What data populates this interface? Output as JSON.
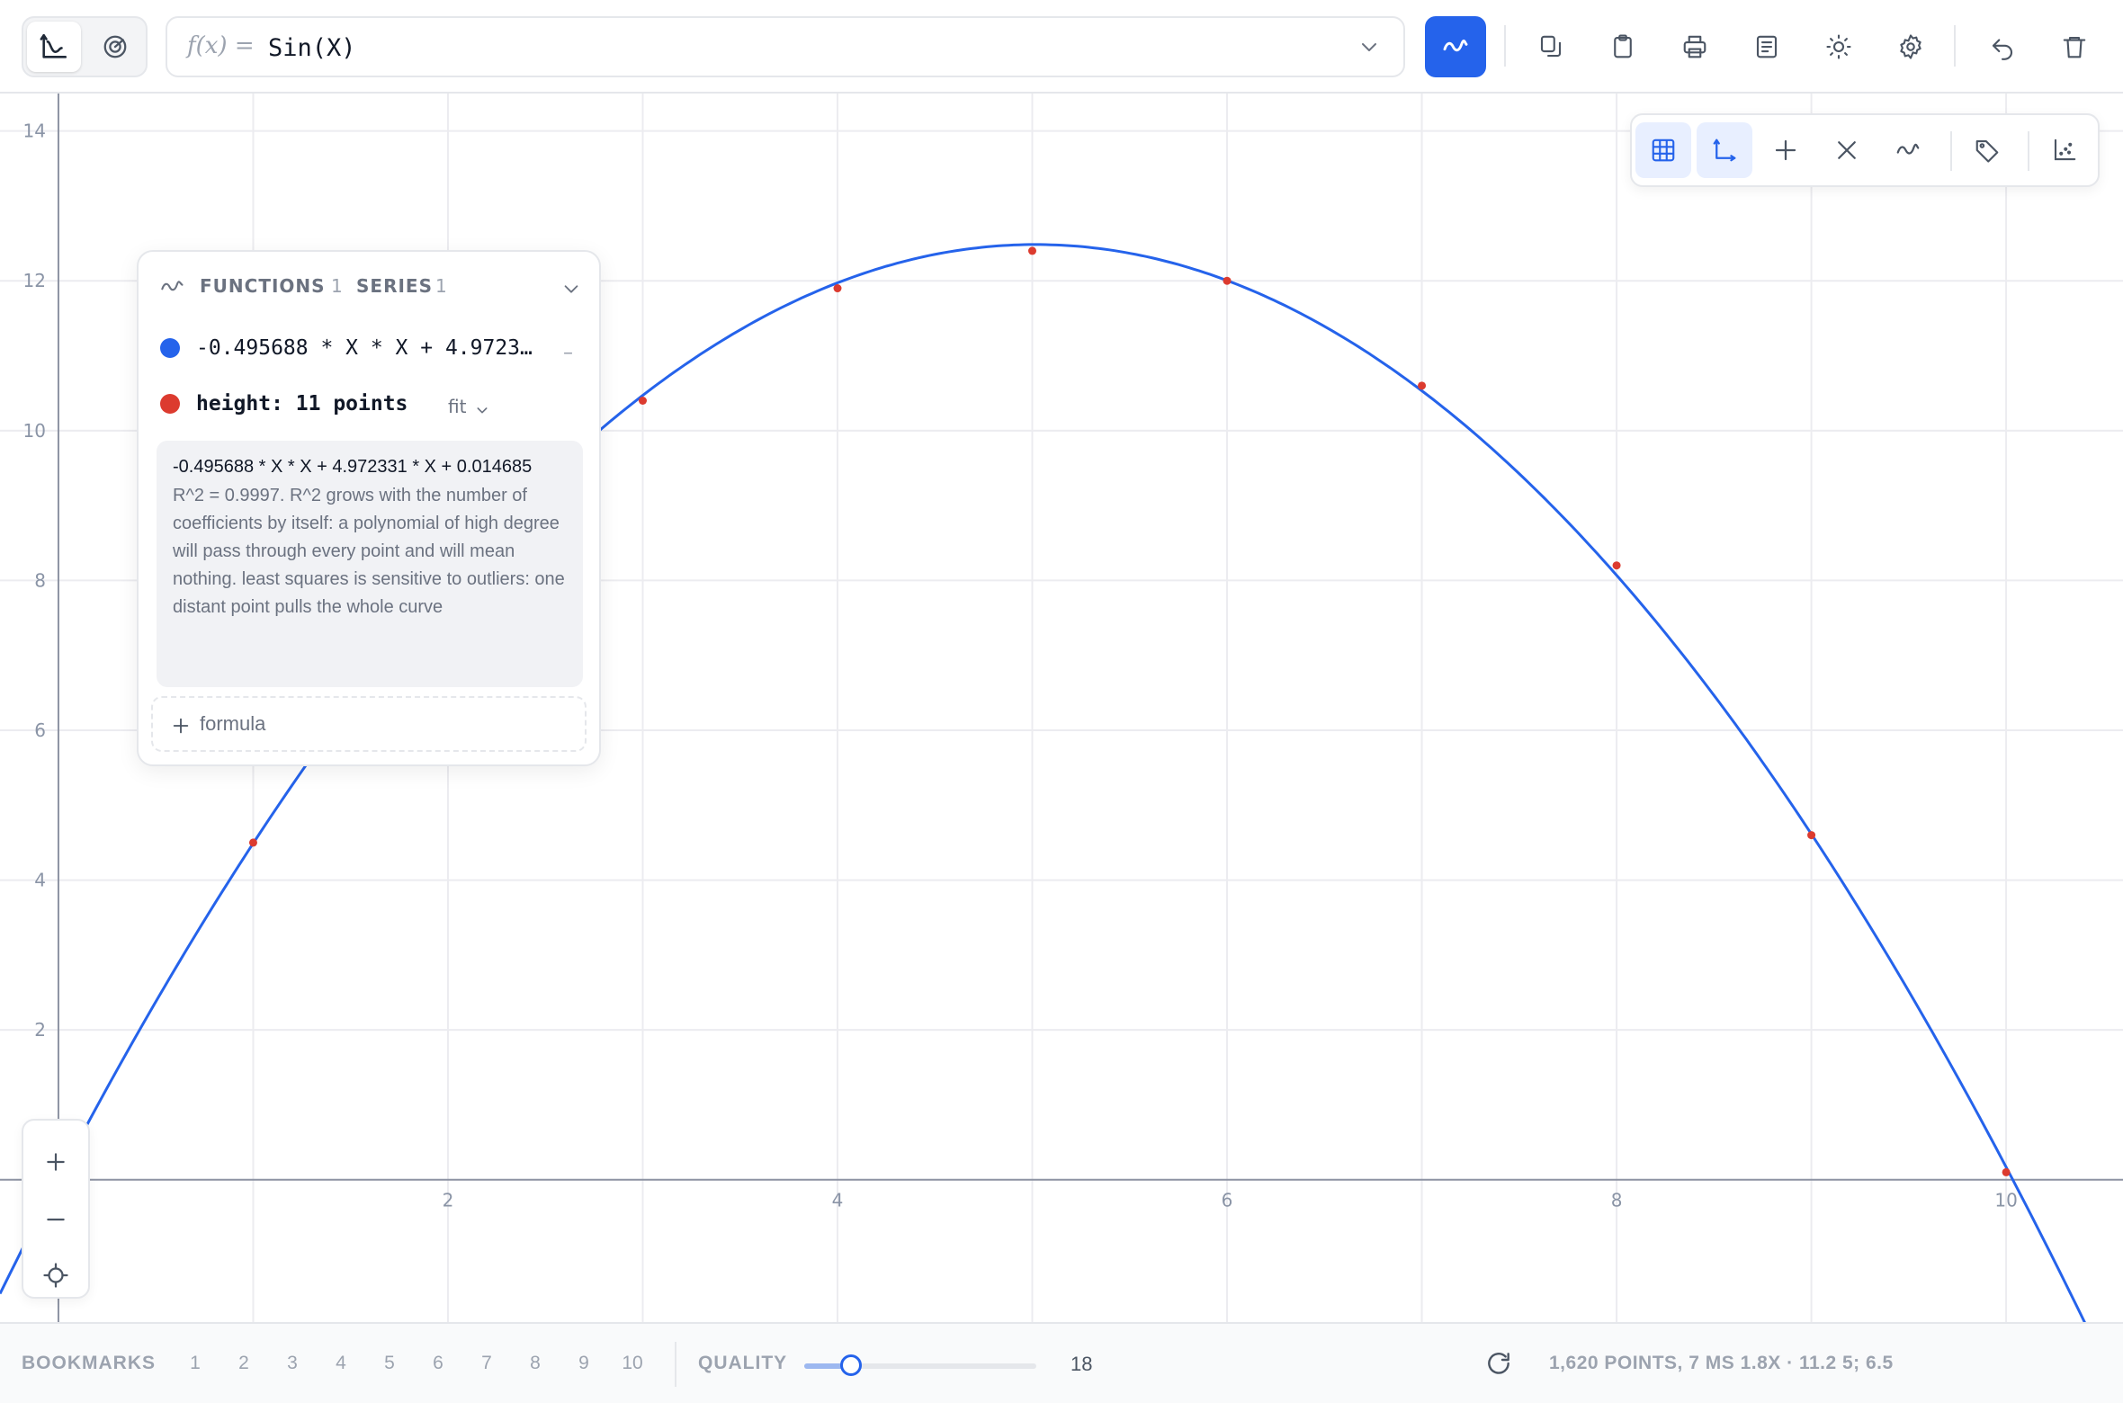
{
  "toolbar": {
    "modes": [
      {
        "name": "graph-mode",
        "icon": "axes-chart-icon",
        "active": true
      },
      {
        "name": "polar-mode",
        "icon": "target-icon",
        "active": false
      }
    ],
    "formula_prefix": "f(x) =",
    "formula_value": "Sin(X)",
    "plot_button_icon": "wave-icon",
    "actions": [
      {
        "name": "copy-button",
        "icon": "copy-icon"
      },
      {
        "name": "paste-button",
        "icon": "clipboard-icon"
      },
      {
        "name": "print-button",
        "icon": "printer-icon"
      },
      {
        "name": "document-button",
        "icon": "document-icon"
      },
      {
        "name": "theme-button",
        "icon": "sun-icon"
      },
      {
        "name": "settings-button",
        "icon": "gear-icon"
      },
      {
        "name": "undo-button",
        "icon": "undo-icon"
      },
      {
        "name": "delete-button",
        "icon": "trash-icon"
      }
    ]
  },
  "plot_tools": [
    {
      "name": "grid-toggle",
      "icon": "grid-icon",
      "active": true
    },
    {
      "name": "axes-toggle",
      "icon": "axes-icon",
      "active": true
    },
    {
      "name": "crosshair-toggle",
      "icon": "plus-icon",
      "active": false
    },
    {
      "name": "intersections-toggle",
      "icon": "x-icon",
      "active": false
    },
    {
      "name": "derivative-toggle",
      "icon": "wave-icon",
      "active": false
    },
    {
      "name": "labels-toggle",
      "icon": "tag-icon",
      "active": false
    },
    {
      "name": "scatter-toggle",
      "icon": "scatter-icon",
      "active": false
    }
  ],
  "panel": {
    "functions_label": "FUNCTIONS",
    "functions_count": "1",
    "series_label": "SERIES",
    "series_count": "1",
    "function_row": {
      "text": "-0.495688 * X * X + 4.9723…",
      "color": "#2563eb"
    },
    "series_row": {
      "text": "height: 11 points",
      "color": "#dc3b2f",
      "fit_label": "fit"
    },
    "fit": {
      "formula": "-0.495688 * X * X + 4.972331 * X + 0.014685",
      "description": "R^2 = 0.9997. R^2 grows with the number of coefficients by itself: a polynomial of high degree will pass through every point and will mean nothing. least squares is sensitive to outliers: one distant point pulls the whole curve"
    },
    "add_formula_label": "formula"
  },
  "chart_data": {
    "type": "scatter",
    "title": "",
    "xlabel": "",
    "ylabel": "",
    "xlim": [
      -0.3,
      10.6
    ],
    "ylim": [
      -1.9,
      14.5
    ],
    "x_ticks": [
      2,
      4,
      6,
      8,
      10
    ],
    "y_ticks": [
      2,
      4,
      6,
      8,
      10,
      12,
      14
    ],
    "grid": true,
    "fit_curve": {
      "a": -0.495688,
      "b": 4.972331,
      "c": 0.014685,
      "color": "#2563eb"
    },
    "series": [
      {
        "name": "height",
        "color": "#dc3b2f",
        "x": [
          0,
          1,
          2,
          3,
          4,
          5,
          6,
          7,
          8,
          9,
          10
        ],
        "y": [
          0.0,
          4.5,
          8.0,
          10.4,
          11.9,
          12.4,
          12.0,
          10.6,
          8.2,
          4.6,
          0.1
        ]
      }
    ]
  },
  "zoom": [
    {
      "name": "zoom-in-button",
      "icon": "plus-icon"
    },
    {
      "name": "zoom-out-button",
      "icon": "minus-icon"
    },
    {
      "name": "recenter-button",
      "icon": "crosshair-icon"
    }
  ],
  "bottom": {
    "bookmarks_label": "BOOKMARKS",
    "bookmarks": [
      "1",
      "2",
      "3",
      "4",
      "5",
      "6",
      "7",
      "8",
      "9",
      "10"
    ],
    "quality_label": "QUALITY",
    "quality_value": "18",
    "quality_fraction": 0.2,
    "status": "1,620 POINTS, 7 MS 1.8X · 11.2 5; 6.5"
  }
}
